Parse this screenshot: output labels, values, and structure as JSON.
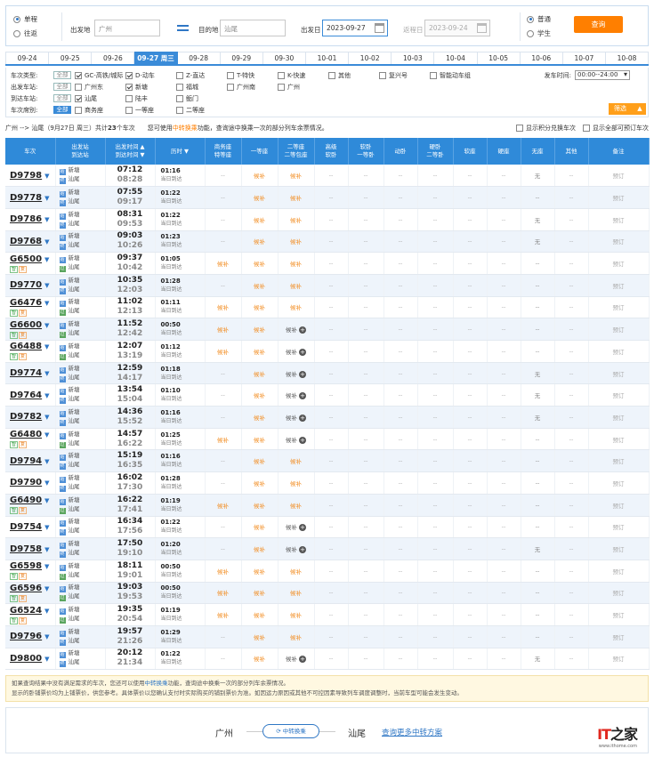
{
  "search": {
    "trip_types": [
      "单程",
      "往返"
    ],
    "from_label": "出发地",
    "from_value": "广州",
    "to_label": "目的地",
    "to_value": "汕尾",
    "depart_label": "出发日",
    "depart_value": "2023-09-27",
    "return_label": "返程日",
    "return_value": "2023-09-24",
    "passenger_types": [
      "普通",
      "学生"
    ],
    "query_label": "查询"
  },
  "dates": [
    "09-24",
    "09-25",
    "09-26",
    "09-27 周三",
    "09-28",
    "09-29",
    "09-30",
    "10-01",
    "10-02",
    "10-03",
    "10-04",
    "10-05",
    "10-06",
    "10-07",
    "10-08"
  ],
  "filters": {
    "all_label": "全部",
    "type_label": "车次类型:",
    "types": [
      {
        "label": "GC-高铁/城际",
        "checked": true
      },
      {
        "label": "D-动车",
        "checked": true
      },
      {
        "label": "Z-直达",
        "checked": false
      },
      {
        "label": "T-特快",
        "checked": false
      },
      {
        "label": "K-快速",
        "checked": false
      },
      {
        "label": "其他",
        "checked": false
      },
      {
        "label": "复兴号",
        "checked": false
      },
      {
        "label": "智能动车组",
        "checked": false
      }
    ],
    "depart_station_label": "出发车站:",
    "depart_stations": [
      {
        "label": "广州东",
        "checked": false
      },
      {
        "label": "新塘",
        "checked": true
      },
      {
        "label": "福城",
        "checked": false
      },
      {
        "label": "广州南",
        "checked": false
      },
      {
        "label": "广州",
        "checked": false
      }
    ],
    "arrive_station_label": "到达车站:",
    "arrive_stations": [
      {
        "label": "汕尾",
        "checked": true
      },
      {
        "label": "陆丰",
        "checked": false
      },
      {
        "label": "鲘门",
        "checked": false
      }
    ],
    "seat_label": "车次席别:",
    "seats": [
      {
        "label": "商务座",
        "checked": false
      },
      {
        "label": "一等座",
        "checked": false
      },
      {
        "label": "二等座",
        "checked": false
      }
    ],
    "time_label": "发车时间:",
    "time_value": "00:00--24:00",
    "filter_btn": "筛选"
  },
  "summary": {
    "route": "广州 --> 汕尾（9月27日 周三）共计",
    "count": "23",
    "unit": "个车次",
    "tip_a": "您可使用",
    "tip_hl": "中转换乘",
    "tip_b": "功能，查询途中换乘一次的部分列车余票情况。",
    "opt1": "显示积分兑换车次",
    "opt2": "显示全部可预订车次"
  },
  "headers": {
    "train": "车次",
    "station_a": "出发站",
    "station_b": "到达站",
    "time_a": "出发时间 ▲",
    "time_b": "到达时间 ▼",
    "duration": "历时 ▼",
    "business_a": "商务座",
    "business_b": "特等座",
    "first": "一等座",
    "second_a": "二等座",
    "second_b": "二等包座",
    "adv_a": "高级",
    "adv_b": "软卧",
    "soft_a": "软卧",
    "soft_b": "一等卧",
    "moving": "动卧",
    "hard_a": "硬卧",
    "hard_b": "二等卧",
    "softseat": "软座",
    "hardseat": "硬座",
    "noseat": "无座",
    "other": "其他",
    "remark": "备注"
  },
  "rows": [
    {
      "no": "D9798",
      "fx": false,
      "from": "新塘",
      "to": "汕尾",
      "dep": "07:12",
      "arr": "08:28",
      "dur": "01:16",
      "note": "当日到达",
      "biz": "--",
      "first": "候补",
      "second": "候补",
      "plus": false,
      "noseat": "无"
    },
    {
      "no": "D9778",
      "fx": false,
      "from": "新塘",
      "to": "汕尾",
      "dep": "07:55",
      "arr": "09:17",
      "dur": "01:22",
      "note": "当日到达",
      "biz": "--",
      "first": "候补",
      "second": "候补",
      "plus": false,
      "noseat": "--"
    },
    {
      "no": "D9786",
      "fx": false,
      "from": "新塘",
      "to": "汕尾",
      "dep": "08:31",
      "arr": "09:53",
      "dur": "01:22",
      "note": "当日到达",
      "biz": "--",
      "first": "候补",
      "second": "候补",
      "plus": false,
      "noseat": "无"
    },
    {
      "no": "D9768",
      "fx": false,
      "from": "新塘",
      "to": "汕尾",
      "dep": "09:03",
      "arr": "10:26",
      "dur": "01:23",
      "note": "当日到达",
      "biz": "--",
      "first": "候补",
      "second": "候补",
      "plus": false,
      "noseat": "无"
    },
    {
      "no": "G6500",
      "fx": true,
      "from": "新塘",
      "to": "汕尾",
      "dep": "09:37",
      "arr": "10:42",
      "dur": "01:05",
      "note": "当日到达",
      "biz": "候补",
      "first": "候补",
      "second": "候补",
      "plus": false,
      "noseat": "--"
    },
    {
      "no": "D9770",
      "fx": false,
      "from": "新塘",
      "to": "汕尾",
      "dep": "10:35",
      "arr": "12:03",
      "dur": "01:28",
      "note": "当日到达",
      "biz": "--",
      "first": "候补",
      "second": "候补",
      "plus": false,
      "noseat": "--"
    },
    {
      "no": "G6476",
      "fx": true,
      "from": "新塘",
      "to": "汕尾",
      "dep": "11:02",
      "arr": "12:13",
      "dur": "01:11",
      "note": "当日到达",
      "biz": "候补",
      "first": "候补",
      "second": "候补",
      "plus": false,
      "noseat": "--"
    },
    {
      "no": "G6600",
      "fx": true,
      "from": "新塘",
      "to": "汕尾",
      "dep": "11:52",
      "arr": "12:42",
      "dur": "00:50",
      "note": "当日到达",
      "biz": "候补",
      "first": "候补",
      "second": "候补",
      "plus": true,
      "noseat": "--"
    },
    {
      "no": "G6488",
      "fx": true,
      "from": "新塘",
      "to": "汕尾",
      "dep": "12:07",
      "arr": "13:19",
      "dur": "01:12",
      "note": "当日到达",
      "biz": "候补",
      "first": "候补",
      "second": "候补",
      "plus": true,
      "noseat": "--"
    },
    {
      "no": "D9774",
      "fx": false,
      "from": "新塘",
      "to": "汕尾",
      "dep": "12:59",
      "arr": "14:17",
      "dur": "01:18",
      "note": "当日到达",
      "biz": "--",
      "first": "候补",
      "second": "候补",
      "plus": true,
      "noseat": "无"
    },
    {
      "no": "D9764",
      "fx": false,
      "from": "新塘",
      "to": "汕尾",
      "dep": "13:54",
      "arr": "15:04",
      "dur": "01:10",
      "note": "当日到达",
      "biz": "--",
      "first": "候补",
      "second": "候补",
      "plus": true,
      "noseat": "无"
    },
    {
      "no": "D9782",
      "fx": false,
      "from": "新塘",
      "to": "汕尾",
      "dep": "14:36",
      "arr": "15:52",
      "dur": "01:16",
      "note": "当日到达",
      "biz": "--",
      "first": "候补",
      "second": "候补",
      "plus": true,
      "noseat": "无"
    },
    {
      "no": "G6480",
      "fx": true,
      "from": "新塘",
      "to": "汕尾",
      "dep": "14:57",
      "arr": "16:22",
      "dur": "01:25",
      "note": "当日到达",
      "biz": "候补",
      "first": "候补",
      "second": "候补",
      "plus": true,
      "noseat": "--"
    },
    {
      "no": "D9794",
      "fx": false,
      "from": "新塘",
      "to": "汕尾",
      "dep": "15:19",
      "arr": "16:35",
      "dur": "01:16",
      "note": "当日到达",
      "biz": "--",
      "first": "候补",
      "second": "候补",
      "plus": false,
      "noseat": "--"
    },
    {
      "no": "D9790",
      "fx": false,
      "from": "新塘",
      "to": "汕尾",
      "dep": "16:02",
      "arr": "17:30",
      "dur": "01:28",
      "note": "当日到达",
      "biz": "--",
      "first": "候补",
      "second": "候补",
      "plus": false,
      "noseat": "--"
    },
    {
      "no": "G6490",
      "fx": true,
      "from": "新塘",
      "to": "汕尾",
      "dep": "16:22",
      "arr": "17:41",
      "dur": "01:19",
      "note": "当日到达",
      "biz": "候补",
      "first": "候补",
      "second": "候补",
      "plus": false,
      "noseat": "--"
    },
    {
      "no": "D9754",
      "fx": false,
      "from": "新塘",
      "to": "汕尾",
      "dep": "16:34",
      "arr": "17:56",
      "dur": "01:22",
      "note": "当日到达",
      "biz": "--",
      "first": "候补",
      "second": "候补",
      "plus": true,
      "noseat": "--"
    },
    {
      "no": "D9758",
      "fx": false,
      "from": "新塘",
      "to": "汕尾",
      "dep": "17:50",
      "arr": "19:10",
      "dur": "01:20",
      "note": "当日到达",
      "biz": "--",
      "first": "候补",
      "second": "候补",
      "plus": true,
      "noseat": "无"
    },
    {
      "no": "G6598",
      "fx": true,
      "from": "新塘",
      "to": "汕尾",
      "dep": "18:11",
      "arr": "19:01",
      "dur": "00:50",
      "note": "当日到达",
      "biz": "候补",
      "first": "候补",
      "second": "候补",
      "plus": false,
      "noseat": "--"
    },
    {
      "no": "G6596",
      "fx": true,
      "from": "新塘",
      "to": "汕尾",
      "dep": "19:03",
      "arr": "19:53",
      "dur": "00:50",
      "note": "当日到达",
      "biz": "候补",
      "first": "候补",
      "second": "候补",
      "plus": false,
      "noseat": "--"
    },
    {
      "no": "G6524",
      "fx": true,
      "from": "新塘",
      "to": "汕尾",
      "dep": "19:35",
      "arr": "20:54",
      "dur": "01:19",
      "note": "当日到达",
      "biz": "候补",
      "first": "候补",
      "second": "候补",
      "plus": false,
      "noseat": "--"
    },
    {
      "no": "D9796",
      "fx": false,
      "from": "新塘",
      "to": "汕尾",
      "dep": "19:57",
      "arr": "21:26",
      "dur": "01:29",
      "note": "当日到达",
      "biz": "--",
      "first": "候补",
      "second": "候补",
      "plus": false,
      "noseat": "--"
    },
    {
      "no": "D9800",
      "fx": false,
      "from": "新塘",
      "to": "汕尾",
      "dep": "20:12",
      "arr": "21:34",
      "dur": "01:22",
      "note": "当日到达",
      "biz": "--",
      "first": "候补",
      "second": "候补",
      "plus": true,
      "noseat": "无"
    }
  ],
  "cell": {
    "dash": "--",
    "book": "预订",
    "badge_fx": "复",
    "badge_smart": "智"
  },
  "notes": {
    "line1_a": "如果查询结果中没有满足需求的车次，您还可以使用",
    "line1_link": "中转换乘",
    "line1_b": "功能，查询途中换乘一次的部分列车余票情况。",
    "line2": "显示的卧铺票价均为上铺票价，供您参考。具体票价以您确认支付时实际购买的铺别票价为准。如因运力原因或其他不可控因素导致列车调度调整时，当前车型可能会发生变动。"
  },
  "transfer": {
    "from": "广州",
    "pill": "中转换乘",
    "to": "汕尾",
    "more": "查询更多中转方案"
  },
  "logo": {
    "text_a": "IT",
    "text_b": "之家",
    "url": "www.ithome.com"
  },
  "colors": {
    "accent": "#2f8ad9",
    "orange": "#ff7f00",
    "waitlist": "#f28a1c"
  }
}
